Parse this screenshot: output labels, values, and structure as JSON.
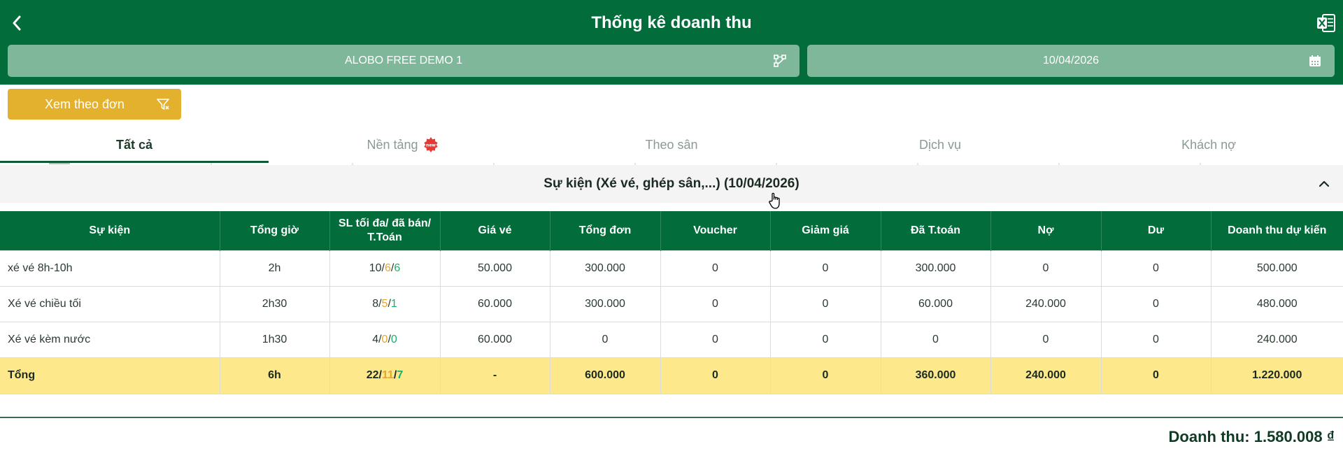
{
  "header": {
    "title": "Thống kê doanh thu",
    "branch": "ALOBO FREE DEMO 1",
    "date": "10/04/2026"
  },
  "view_button": {
    "label": "Xem theo đơn"
  },
  "tabs": [
    {
      "label": "Tất cả",
      "active": true
    },
    {
      "label": "Nền tảng",
      "active": false,
      "badge": "new"
    },
    {
      "label": "Theo sân",
      "active": false
    },
    {
      "label": "Dịch vụ",
      "active": false
    },
    {
      "label": "Khách nợ",
      "active": false
    }
  ],
  "section": {
    "title": "Sự kiện (Xé vé, ghép sân,...) (10/04/2026)"
  },
  "table": {
    "columns": [
      "Sự kiện",
      "Tổng giờ",
      "SL tối đa/ đã bán/ T.Toán",
      "Giá vé",
      "Tổng đơn",
      "Voucher",
      "Giảm giá",
      "Đã T.toán",
      "Nợ",
      "Dư",
      "Doanh thu dự kiến"
    ],
    "rows": [
      {
        "name": "xé vé 8h-10h",
        "hours": "2h",
        "max": "10",
        "sold": "6",
        "paid_count": "6",
        "price": "50.000",
        "total": "300.000",
        "voucher": "0",
        "discount": "0",
        "paid": "300.000",
        "debt": "0",
        "surplus": "0",
        "expected": "500.000"
      },
      {
        "name": "Xé vé chiều tối",
        "hours": "2h30",
        "max": "8",
        "sold": "5",
        "paid_count": "1",
        "price": "60.000",
        "total": "300.000",
        "voucher": "0",
        "discount": "0",
        "paid": "60.000",
        "debt": "240.000",
        "surplus": "0",
        "expected": "480.000"
      },
      {
        "name": "Xé vé kèm nước",
        "hours": "1h30",
        "max": "4",
        "sold": "0",
        "paid_count": "0",
        "price": "60.000",
        "total": "0",
        "voucher": "0",
        "discount": "0",
        "paid": "0",
        "debt": "0",
        "surplus": "0",
        "expected": "240.000"
      }
    ],
    "total": {
      "name": "Tổng",
      "hours": "6h",
      "max": "22",
      "sold": "11",
      "paid_count": "7",
      "price": "-",
      "total": "600.000",
      "voucher": "0",
      "discount": "0",
      "paid": "360.000",
      "debt": "240.000",
      "surplus": "0",
      "expected": "1.220.000"
    }
  },
  "footer": {
    "revenue": "Doanh thu: 1.580.008 ₫"
  },
  "colors": {
    "primary": "#026c3a",
    "selector": "#7fb79b",
    "accent": "#e3b12e",
    "total_row": "#fde98c",
    "paid": "#1dae6a",
    "debt": "#e6532a",
    "sold": "#e8a52e"
  },
  "icons": [
    "back-arrow-icon",
    "excel-icon",
    "branch-icon",
    "calendar-icon",
    "funnel-icon",
    "new-badge-icon",
    "chevron-up-icon",
    "hand-cursor-icon"
  ]
}
